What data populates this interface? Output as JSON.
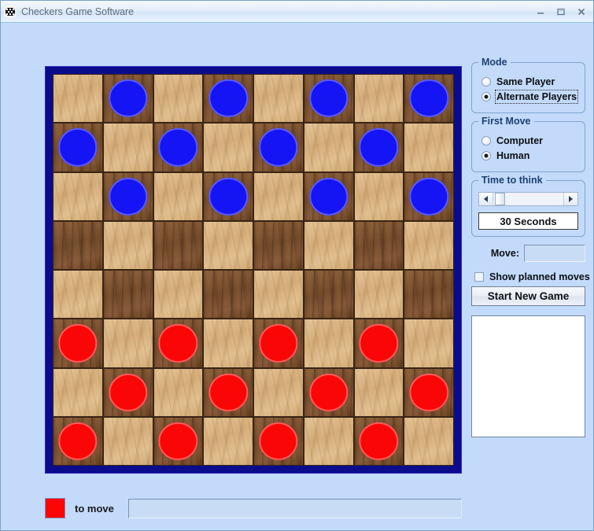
{
  "window": {
    "title": "Checkers Game Software",
    "app_icon": "checkers-app-icon",
    "background_color": "#c3dafa",
    "buttons": {
      "minimize": "minimize-icon",
      "maximize": "maximize-icon",
      "close": "close-icon",
      "close_glyph": "X"
    }
  },
  "board": {
    "border_color": "#0b0b8e",
    "light_square_color": "#dcb683",
    "dark_square_color": "#795030",
    "blue_piece_color": "#1414f5",
    "red_piece_color": "#fb0606",
    "rows": 8,
    "cols": 8,
    "cells": [
      [
        "",
        "blue",
        "",
        "blue",
        "",
        "blue",
        "",
        "blue"
      ],
      [
        "blue",
        "",
        "blue",
        "",
        "blue",
        "",
        "blue",
        ""
      ],
      [
        "",
        "blue",
        "",
        "blue",
        "",
        "blue",
        "",
        "blue"
      ],
      [
        "",
        "",
        "",
        "",
        "",
        "",
        "",
        ""
      ],
      [
        "",
        "",
        "",
        "",
        "",
        "",
        "",
        ""
      ],
      [
        "red",
        "",
        "red",
        "",
        "red",
        "",
        "red",
        ""
      ],
      [
        "",
        "red",
        "",
        "red",
        "",
        "red",
        "",
        "red"
      ],
      [
        "red",
        "",
        "red",
        "",
        "red",
        "",
        "red",
        ""
      ]
    ],
    "dark_offsets": [
      1,
      0,
      1,
      0,
      1,
      0,
      1,
      0
    ]
  },
  "status": {
    "turn_color": "#fb0606",
    "turn_label": "to move",
    "message": ""
  },
  "panel": {
    "mode": {
      "title": "Mode",
      "options": [
        {
          "label": "Same Player",
          "selected": false,
          "focused": false
        },
        {
          "label": "Alternate Players",
          "selected": true,
          "focused": true
        }
      ]
    },
    "first_move": {
      "title": "First Move",
      "options": [
        {
          "label": "Computer",
          "selected": false,
          "focused": false
        },
        {
          "label": "Human",
          "selected": true,
          "focused": false
        }
      ]
    },
    "time_to_think": {
      "title": "Time to think",
      "value_label": "30 Seconds",
      "slider": {
        "left_arrow": "arrow-left-icon",
        "right_arrow": "arrow-right-icon",
        "thumb_position_percent": 2
      }
    },
    "move": {
      "label": "Move:",
      "value": "",
      "placeholder": ""
    },
    "show_planned_moves": {
      "label": "Show planned moves",
      "checked": false
    },
    "start_new_game": {
      "label": "Start New Game"
    },
    "log": {
      "items": []
    }
  }
}
